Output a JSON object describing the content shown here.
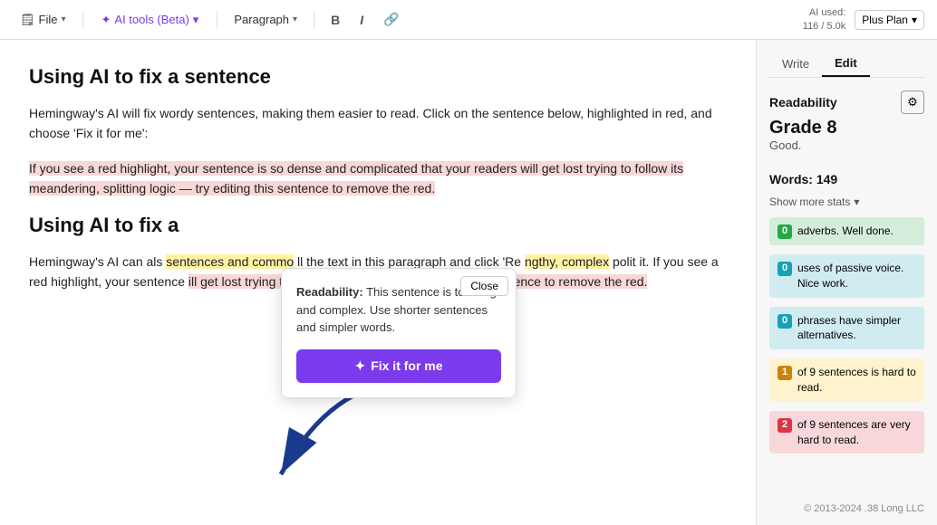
{
  "toolbar": {
    "file_label": "File",
    "ai_tools_label": "AI tools (Beta)",
    "paragraph_label": "Paragraph",
    "bold_label": "B",
    "italic_label": "I",
    "link_label": "🔗",
    "ai_used_label": "AI used:",
    "ai_count": "116 / 5.0k",
    "plan_label": "Plus Plan"
  },
  "sidebar": {
    "write_tab": "Write",
    "edit_tab": "Edit",
    "readability_label": "Readability",
    "grade_label": "Grade 8",
    "good_label": "Good.",
    "words_label": "Words: 149",
    "show_more_stats": "Show more stats",
    "badges": [
      {
        "num": "0",
        "text": "adverbs. Well done.",
        "color": "green"
      },
      {
        "num": "0",
        "text": "uses of passive voice. Nice work.",
        "color": "blue"
      },
      {
        "num": "0",
        "text": "phrases have simpler alternatives.",
        "color": "blue"
      },
      {
        "num": "1",
        "text": "of 9 sentences is hard to read.",
        "color": "yellow"
      },
      {
        "num": "2",
        "text": "of 9 sentences are very hard to read.",
        "color": "red"
      }
    ]
  },
  "editor": {
    "heading1": "Using AI to fix a sentence",
    "para1": "Hemingway's AI will fix wordy sentences, making them easier to read. Click on the sentence below, highlighted in red, and choose 'Fix it for me':",
    "highlighted_sentence": "If you see a red highlight, your sentence is so dense and complicated that your readers will get lost trying to follow its meandering, splitting logic — try editing this sentence to remove the red.",
    "heading2": "Using AI to fix a",
    "para2_before": "Hemingway's AI can als",
    "para2_yellow1": "sentences and commo",
    "para2_after": "ll the text in this paragraph and click 'Re",
    "para2_yellow2": "ngthy, complex",
    "para2_mid": "plit it. If you see a red highlight, your sentenc",
    "para2_red": "ill get lost trying to follow its meandering, splitting this sentence to remove the red.",
    "dot": "."
  },
  "popup": {
    "close_label": "Close",
    "readability_label": "Readability:",
    "readability_text": "This sentence is too long and complex. Use shorter sentences and simpler words.",
    "fix_it_label": "Fix it for me"
  },
  "footer": {
    "text": "© 2013-2024 .38 Long LLC"
  }
}
